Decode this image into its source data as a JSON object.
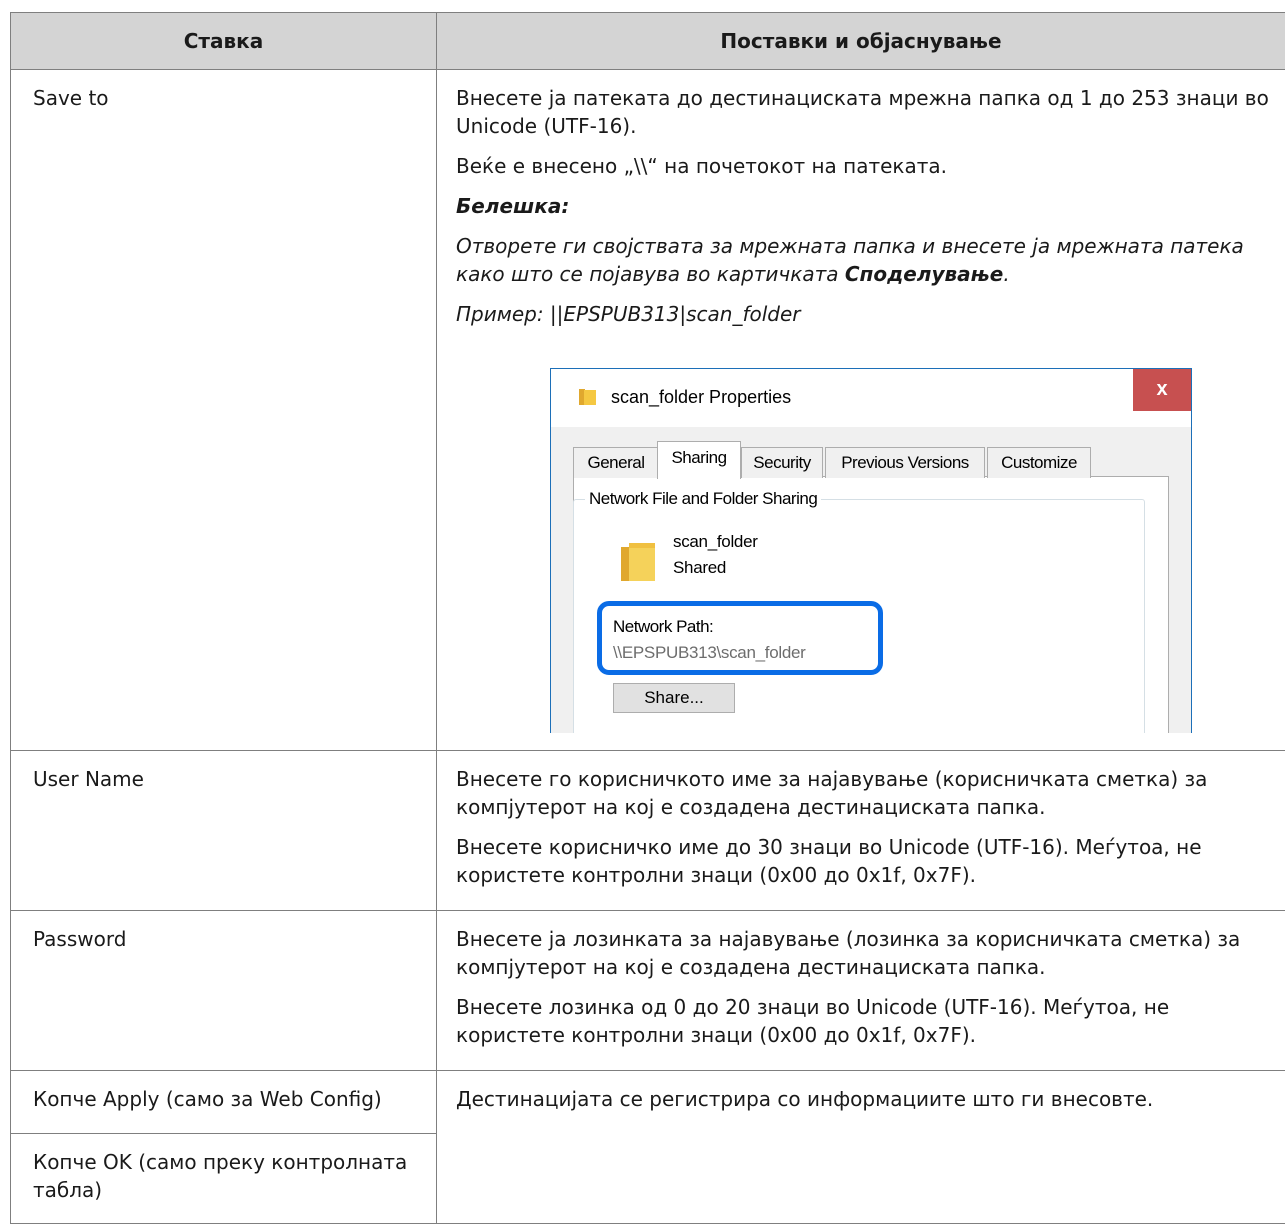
{
  "table": {
    "headers": [
      "Ставка",
      "Поставки и објаснување"
    ],
    "save_to": {
      "label": "Save to",
      "p1": "Внесете ја патеката до дестинациската мрежна папка од 1 до 253 знаци во Unicode (UTF-16).",
      "p2": "Веќе е внесено „\\\\“ на почетокот на патеката.",
      "note_heading": "Белешка:",
      "note_text_before": "Отворете ги својствата за мрежната папка и внесете ја мрежната патека како што се појавува во картичката ",
      "note_bold": "Споделување",
      "note_text_after": ".",
      "example": "Пример: ||EPSPUB313|scan_folder"
    },
    "user_name": {
      "label": "User Name",
      "p1": "Внесете го корисничкото име за најавување (корисничката сметка) за компјутерот на кој е создадена дестинациската папка.",
      "p2": "Внесете корисничко име до 30 знаци во Unicode (UTF-16). Меѓутоа, не користете контролни знаци (0x00 до 0x1f, 0x7F)."
    },
    "password": {
      "label": "Password",
      "p1": "Внесете ја лозинката за најавување (лозинка за корисничката сметка) за компјутерот на кој е создадена дестинациската папка.",
      "p2": "Внесете лозинка од 0 до 20 знаци во Unicode (UTF-16). Меѓутоа, не користете контролни знаци (0x00 до 0x1f, 0x7F)."
    },
    "apply": {
      "label": "Копче Apply (само за Web Config)",
      "desc": "Дестинацијата се регистрира со информациите што ги внесовте."
    },
    "ok": {
      "label": "Копче OK (само преку контролната табла)"
    }
  },
  "dialog": {
    "title": "scan_folder Properties",
    "close_label": "x",
    "tabs": [
      "General",
      "Sharing",
      "Security",
      "Previous Versions",
      "Customize"
    ],
    "active_tab": "Sharing",
    "group_label": "Network File and Folder Sharing",
    "folder_name": "scan_folder",
    "folder_state": "Shared",
    "network_path_label": "Network Path:",
    "network_path_value": "\\\\EPSPUB313\\scan_folder",
    "share_button": "Share...",
    "colors": {
      "highlight": "#0a6ce6",
      "close": "#c75050",
      "folder": "#f5c842"
    },
    "icons": [
      "folder-icon",
      "close-icon",
      "shared-folder-icon"
    ]
  },
  "colors": {
    "header_bg": "#d4d4d4",
    "border": "#7f7f7f"
  }
}
